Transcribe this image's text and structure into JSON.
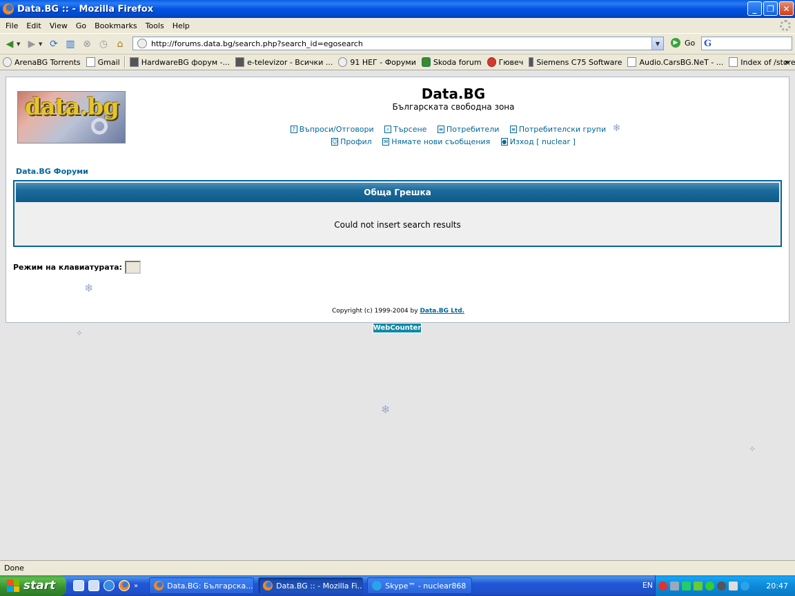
{
  "window": {
    "title": "Data.BG :: - Mozilla Firefox"
  },
  "menu": [
    "File",
    "Edit",
    "View",
    "Go",
    "Bookmarks",
    "Tools",
    "Help"
  ],
  "nav": {
    "url": "http://forums.data.bg/search.php?search_id=egosearch",
    "go_label": "Go",
    "search_placeholder": ""
  },
  "bookmarks": [
    {
      "label": "ArenaBG Torrents",
      "icon": "circle"
    },
    {
      "label": "Gmail",
      "icon": "page"
    },
    {
      "label": "HardwareBG форум -...",
      "icon": "dark"
    },
    {
      "label": "e-televizor - Всички ...",
      "icon": "dark"
    },
    {
      "label": "91 НЕГ - Форуми",
      "icon": "circle"
    },
    {
      "label": "Skoda forum",
      "icon": "green"
    },
    {
      "label": "Гювеч",
      "icon": "red"
    },
    {
      "label": "Siemens C75 Software",
      "icon": "dark"
    },
    {
      "label": "Audio.CarsBG.NeT - ...",
      "icon": "page"
    },
    {
      "label": "Index of /store",
      "icon": "page"
    }
  ],
  "bookmarks_more": "»",
  "page": {
    "site_title": "Data.BG",
    "site_desc": "Българската свободна зона",
    "logo_text": "data.bg",
    "nav_row1": [
      "Въпроси/Отговори",
      "Търсене",
      "Потребители",
      "Потребителски групи"
    ],
    "nav_row2": [
      "Профил",
      "Нямате нови съобщения",
      "Изход [ nuclear ]"
    ],
    "forum_link": "Data.BG Форуми",
    "error_title": "Обща Грешка",
    "error_message": "Could not insert search results",
    "keyboard_label": "Режим на клавиатурата:",
    "copyright_prefix": "Copyright (c) 1999-2004 by ",
    "copyright_link": "Data.BG Ltd.",
    "webcounter": "WebCounter"
  },
  "status": "Done",
  "taskbar": {
    "start": "start",
    "tasks": [
      {
        "label": "Data.BG: Българска...",
        "icon": "firefox",
        "active": false
      },
      {
        "label": "Data.BG :: - Mozilla Fi...",
        "icon": "firefox",
        "active": true
      },
      {
        "label": "Skype™ - nuclear868",
        "icon": "skype",
        "active": false
      }
    ],
    "lang": "EN",
    "clock": "20:47"
  },
  "colors": {
    "link": "#006699",
    "error_border": "#006699",
    "page_bg": "#e5e5e5"
  }
}
